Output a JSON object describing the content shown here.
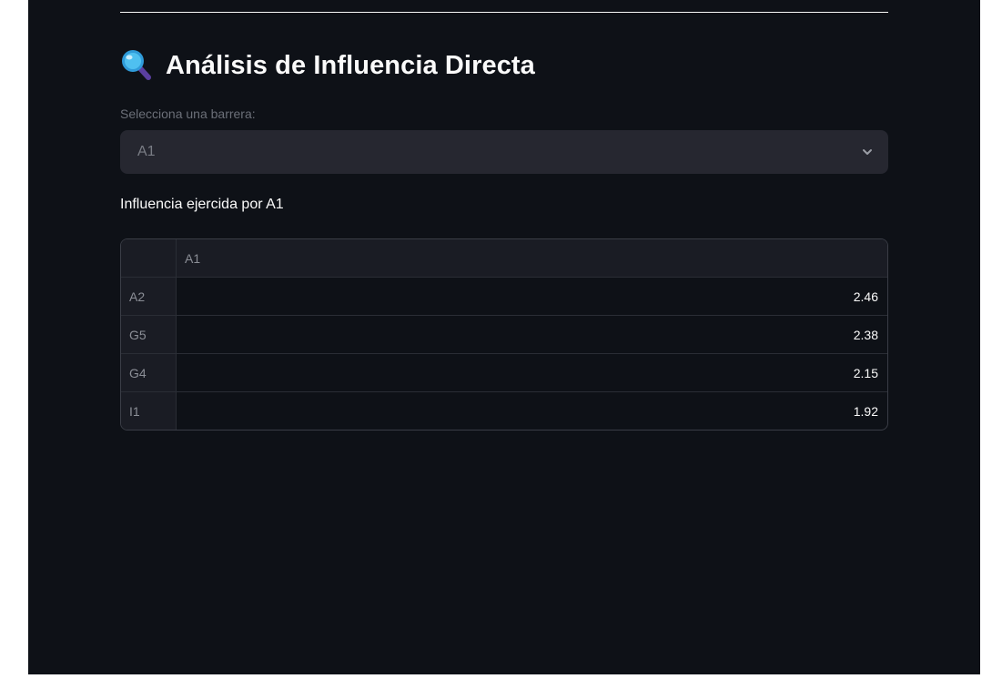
{
  "page": {
    "title": "Análisis de Influencia Directa",
    "title_icon": "magnifying-glass-icon"
  },
  "selector": {
    "label": "Selecciona una barrera:",
    "value": "A1",
    "icon": "chevron-down-icon"
  },
  "section": {
    "heading": "Influencia ejercida por A1"
  },
  "table": {
    "column_header": "A1",
    "rows": [
      {
        "index": "A2",
        "value": "2.46"
      },
      {
        "index": "G5",
        "value": "2.38"
      },
      {
        "index": "G4",
        "value": "2.15"
      },
      {
        "index": "I1",
        "value": "1.92"
      }
    ]
  },
  "colors": {
    "background": "#0e1117",
    "text": "#fafafa",
    "select_bg": "#262730"
  }
}
